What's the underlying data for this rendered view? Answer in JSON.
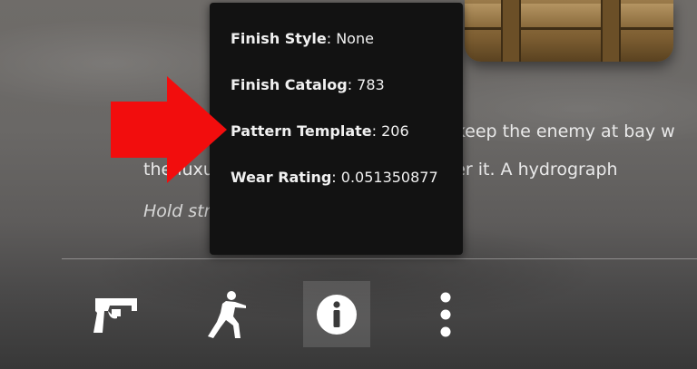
{
  "tooltip": {
    "finish_style": {
      "label": "Finish Style",
      "value": ": None"
    },
    "finish_catalog": {
      "label": "Finish Catalog",
      "value": ": 783"
    },
    "pattern_template": {
      "label": "Pattern Template",
      "value": ": 206"
    },
    "wear_rating": {
      "label": "Wear Rating",
      "value": ": 0.051350877"
    }
  },
  "description": {
    "line1": "Let's play defense. A team that can keep the enemy at bay w",
    "line2": "the luxury of time to gain control over it. A hydrograph",
    "quote": "Hold strong"
  },
  "toolbar": {
    "items": [
      {
        "icon": "pistol-icon"
      },
      {
        "icon": "soldier-icon"
      },
      {
        "icon": "info-icon",
        "selected": true
      },
      {
        "icon": "more-vertical-icon"
      }
    ]
  },
  "colors": {
    "tooltip_bg": "#121212",
    "arrow": "#f20d0d",
    "selected_button_bg": "rgba(255,255,255,0.13)"
  }
}
